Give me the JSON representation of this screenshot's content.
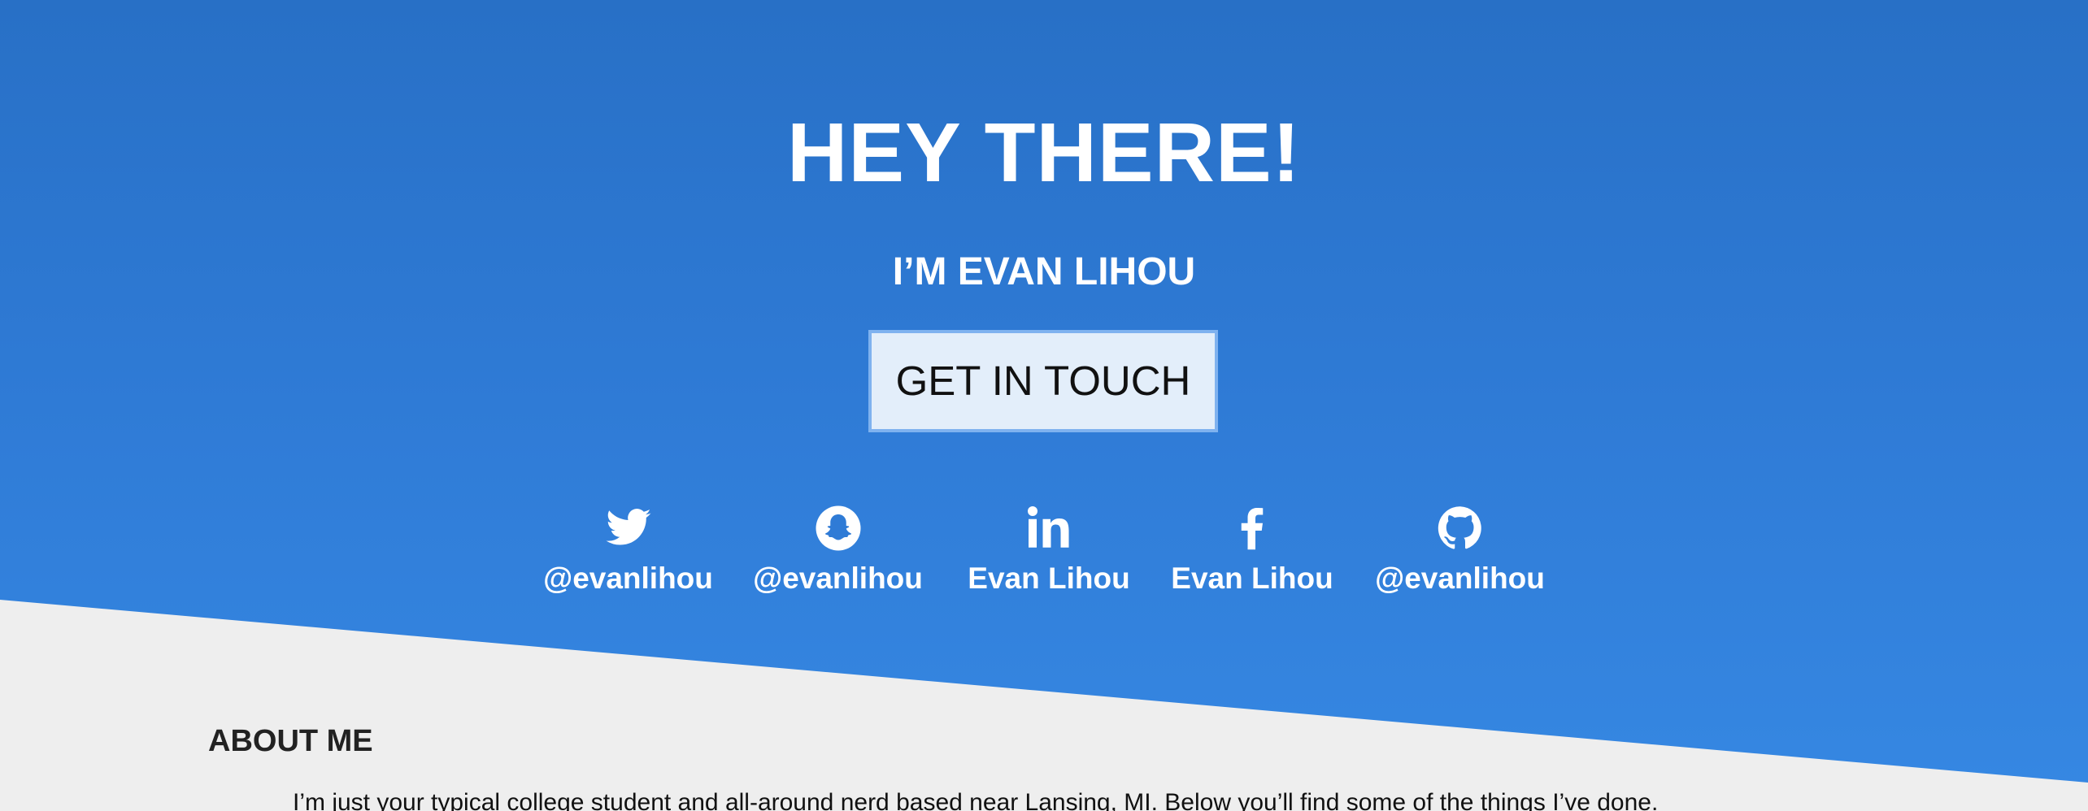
{
  "hero": {
    "title": "HEY THERE!",
    "subtitle": "I’M EVAN LIHOU",
    "cta_label": "GET IN TOUCH"
  },
  "socials": [
    {
      "icon": "twitter-icon",
      "handle": "@evanlihou"
    },
    {
      "icon": "snapchat-icon",
      "handle": "@evanlihou"
    },
    {
      "icon": "linkedin-icon",
      "handle": "Evan Lihou"
    },
    {
      "icon": "facebook-icon",
      "handle": "Evan Lihou"
    },
    {
      "icon": "github-icon",
      "handle": "@evanlihou"
    }
  ],
  "about": {
    "title": "ABOUT ME",
    "text": "I’m just your typical college student and all-around nerd based near Lansing, MI. Below you’ll find some of the things I’ve done."
  },
  "colors": {
    "hero_gradient_top": "#2870c6",
    "hero_gradient_bottom": "#3688e3",
    "page_background": "#eeeeee",
    "cta_background": "#e3eefa",
    "cta_border": "#7fb2ef"
  }
}
